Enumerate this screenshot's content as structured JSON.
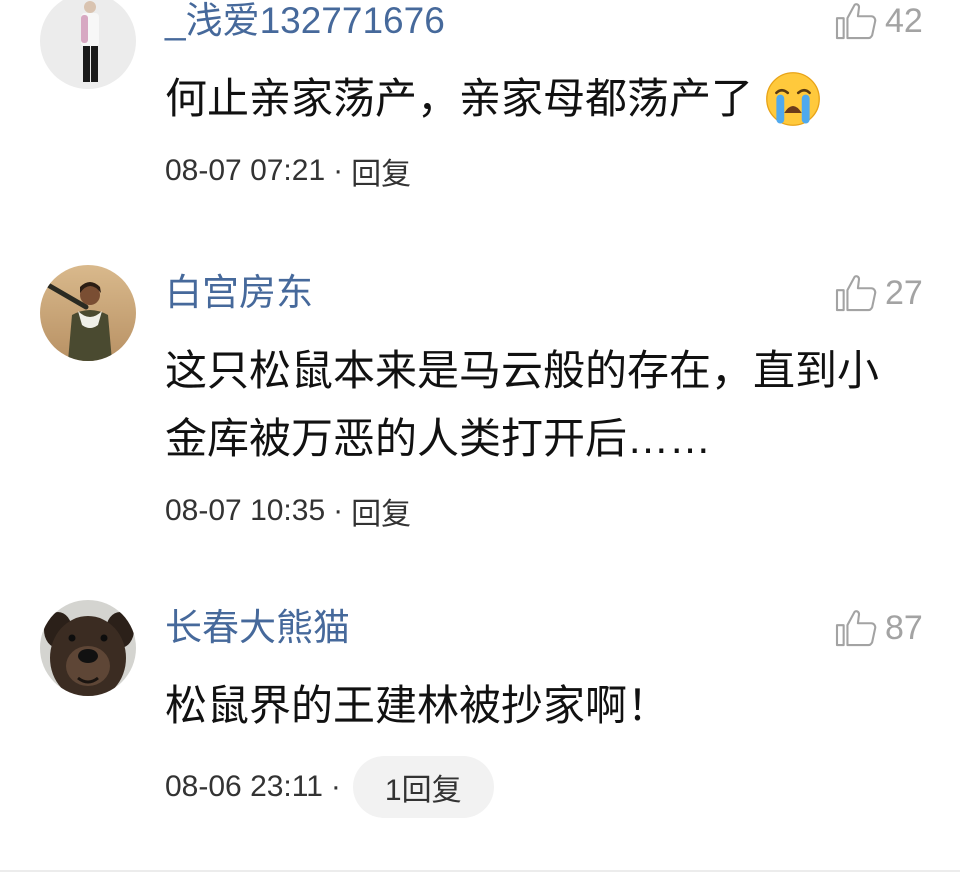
{
  "comments": [
    {
      "username": "_浅爱132771676",
      "likes": "42",
      "text_lines": [
        "何止亲家荡产，亲家母都荡产了"
      ],
      "emoji": "loudly-crying-face",
      "time": "08-07 07:21",
      "separator": "·",
      "reply_label": "回复"
    },
    {
      "username": "白宫房东",
      "likes": "27",
      "text_lines": [
        "这只松鼠本来是马云般的存在，直到小",
        "金库被万恶的人类打开后……"
      ],
      "time": "08-07 10:35",
      "separator": "·",
      "reply_label": "回复"
    },
    {
      "username": "长春大熊猫",
      "likes": "87",
      "text_lines": [
        "松鼠界的王建林被抄家啊！"
      ],
      "time": "08-06 23:11",
      "separator": "·",
      "reply_count_label": "1回复"
    }
  ],
  "icons": {
    "like": "thumbs-up-icon"
  },
  "colors": {
    "username": "#46699b",
    "text": "#111111",
    "meta": "#333333",
    "like": "#a3a3a3",
    "pill_bg": "#f2f2f2",
    "divider": "#ececec"
  }
}
